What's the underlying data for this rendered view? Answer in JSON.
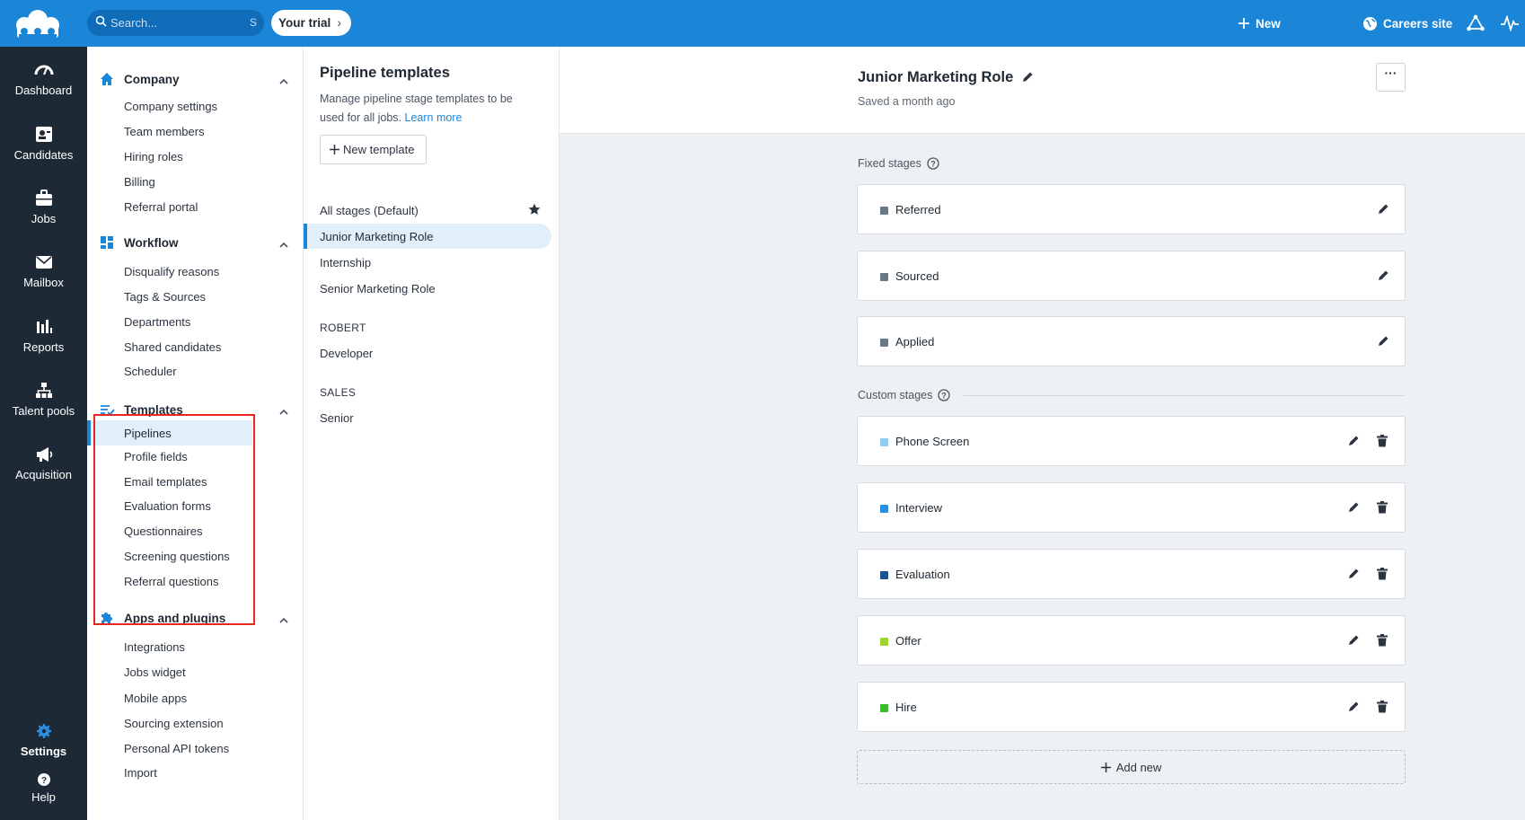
{
  "topbar": {
    "search_placeholder": "Search...",
    "search_shortcut": "S",
    "trial_label": "Your trial",
    "new_label": "New",
    "careers_label": "Careers site",
    "brand_color": "#1b86d8"
  },
  "leftnav": {
    "items": [
      {
        "label": "Dashboard",
        "icon": "dashboard-icon"
      },
      {
        "label": "Candidates",
        "icon": "candidates-icon"
      },
      {
        "label": "Jobs",
        "icon": "briefcase-icon"
      },
      {
        "label": "Mailbox",
        "icon": "mail-icon"
      },
      {
        "label": "Reports",
        "icon": "bar-chart-icon"
      },
      {
        "label": "Talent pools",
        "icon": "org-chart-icon"
      },
      {
        "label": "Acquisition",
        "icon": "megaphone-icon"
      }
    ],
    "settings_label": "Settings",
    "help_label": "Help"
  },
  "settings_sidebar": {
    "sections": [
      {
        "title": "Company",
        "items": [
          "Company settings",
          "Team members",
          "Hiring roles",
          "Billing",
          "Referral portal"
        ]
      },
      {
        "title": "Workflow",
        "items": [
          "Disqualify reasons",
          "Tags & Sources",
          "Departments",
          "Shared candidates",
          "Scheduler"
        ]
      },
      {
        "title": "Templates",
        "items": [
          "Pipelines",
          "Profile fields",
          "Email templates",
          "Evaluation forms",
          "Questionnaires",
          "Screening questions",
          "Referral questions"
        ]
      },
      {
        "title": "Apps and plugins",
        "items": [
          "Integrations",
          "Jobs widget",
          "Mobile apps",
          "Sourcing extension",
          "Personal API tokens",
          "Import"
        ]
      }
    ],
    "active_item": "Pipelines"
  },
  "pipeline": {
    "title": "Pipeline templates",
    "description": "Manage pipeline stage templates to be used for all jobs.",
    "learn_more": "Learn more",
    "new_template_label": "New template",
    "templates": [
      "All stages (Default)",
      "Junior Marketing Role",
      "Internship",
      "Senior Marketing Role"
    ],
    "groups": [
      {
        "name": "ROBERT",
        "items": [
          "Developer"
        ]
      },
      {
        "name": "SALES",
        "items": [
          "Senior"
        ]
      }
    ]
  },
  "main": {
    "title": "Junior Marketing Role",
    "saved": "Saved a month ago",
    "more_label": "···",
    "fixed_label": "Fixed stages",
    "custom_label": "Custom stages",
    "fixed_stages": [
      {
        "name": "Referred",
        "color": "#6b7785"
      },
      {
        "name": "Sourced",
        "color": "#6b7785"
      },
      {
        "name": "Applied",
        "color": "#6b7785"
      }
    ],
    "custom_stages": [
      {
        "name": "Phone Screen",
        "color": "#8fcdf2"
      },
      {
        "name": "Interview",
        "color": "#2a8fe0"
      },
      {
        "name": "Evaluation",
        "color": "#1a5490"
      },
      {
        "name": "Offer",
        "color": "#9bd52e"
      },
      {
        "name": "Hire",
        "color": "#3cb92c"
      }
    ],
    "add_new_label": "Add new"
  }
}
